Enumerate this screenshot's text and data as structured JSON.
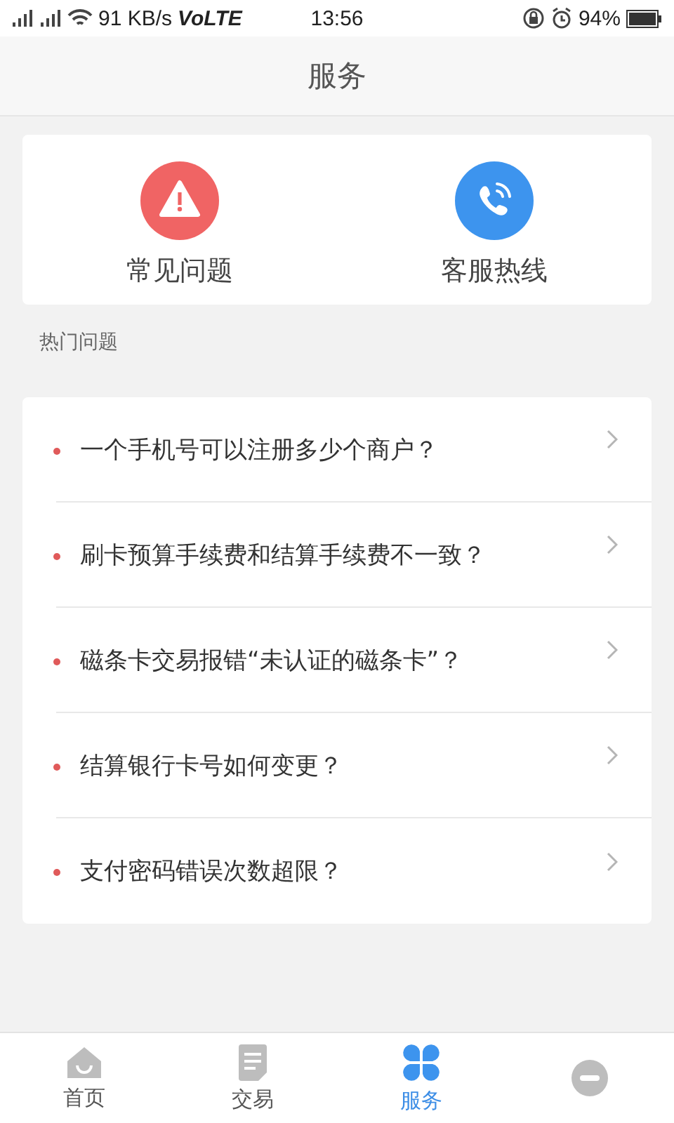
{
  "status_bar": {
    "speed": "91 KB/s",
    "network": "VoLTE",
    "time": "13:56",
    "battery": "94%"
  },
  "header": {
    "title": "服务"
  },
  "shortcuts": [
    {
      "label": "常见问题",
      "kind": "faq"
    },
    {
      "label": "客服热线",
      "kind": "hotline"
    }
  ],
  "section_title": "热门问题",
  "questions": [
    "一个手机号可以注册多少个商户？",
    "刷卡预算手续费和结算手续费不一致？",
    "磁条卡交易报错“未认证的磁条卡”？",
    "结算银行卡号如何变更？",
    "支付密码错误次数超限？"
  ],
  "tabs": [
    {
      "label": "首页",
      "kind": "home",
      "selected": false
    },
    {
      "label": "交易",
      "kind": "trade",
      "selected": false
    },
    {
      "label": "服务",
      "kind": "service",
      "selected": true
    },
    {
      "kind": "profile",
      "selected": false
    }
  ]
}
